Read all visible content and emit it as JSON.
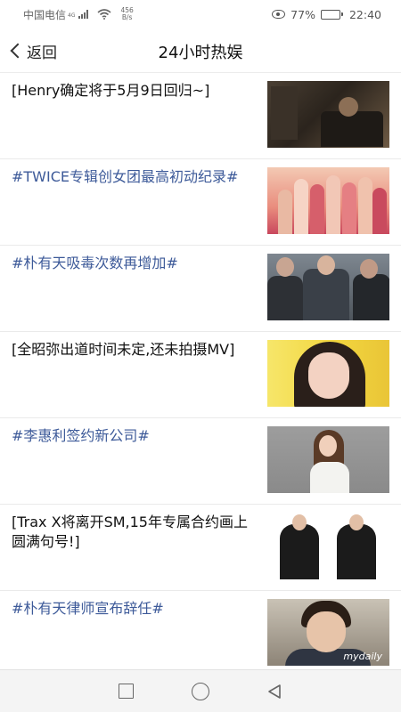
{
  "status_bar": {
    "carrier": "中国电信",
    "network": "4G",
    "speed_value": "456",
    "speed_unit": "B/s",
    "battery": "77%",
    "battery_level": 0.77,
    "time": "22:40"
  },
  "header": {
    "back_label": "返回",
    "title": "24小时热娱"
  },
  "colors": {
    "topic_text": "#3d5a99",
    "normal_text": "#111111"
  },
  "items": [
    {
      "title": "[Henry确定将于5月9日回归~]",
      "style": "normal"
    },
    {
      "title": "#TWICE专辑创女团最高初动纪录#",
      "style": "topic"
    },
    {
      "title": "#朴有天吸毒次数再增加#",
      "style": "topic"
    },
    {
      "title": "[全昭弥出道时间未定,还未拍摄MV]",
      "style": "normal"
    },
    {
      "title": "#李惠利签约新公司#",
      "style": "topic"
    },
    {
      "title": "[Trax X将离开SM,15年专属合约画上圆满句号!]",
      "style": "normal"
    },
    {
      "title": "#朴有天律师宣布辞任#",
      "style": "topic"
    }
  ],
  "thumb_watermark": "mydaily",
  "nav": {
    "recent": "square-icon",
    "home": "circle-icon",
    "back": "triangle-back-icon"
  }
}
